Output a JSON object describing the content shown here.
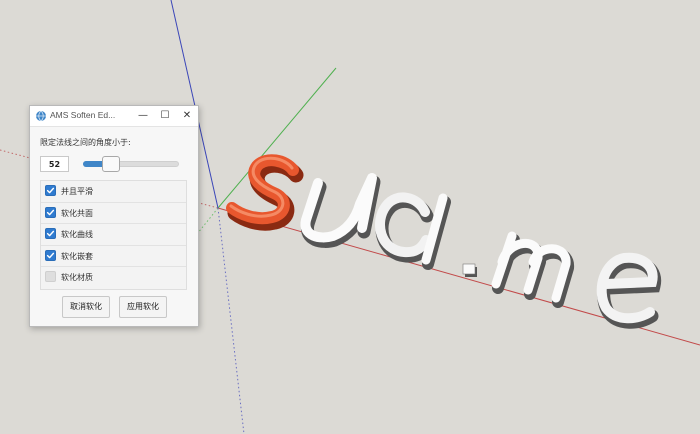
{
  "window": {
    "title": "AMS Soften Ed...",
    "minimize_glyph": "—",
    "maximize_glyph": "☐",
    "close_glyph": "✕"
  },
  "angle": {
    "label": "限定法线之间的角度小于:",
    "value": "52",
    "slider_min": 0,
    "slider_max": 180
  },
  "options": [
    {
      "label": "并且平滑",
      "checked": true
    },
    {
      "label": "软化共面",
      "checked": true
    },
    {
      "label": "软化曲线",
      "checked": true
    },
    {
      "label": "软化嵌套",
      "checked": true
    },
    {
      "label": "软化材质",
      "checked": false
    }
  ],
  "buttons": {
    "cancel_label": "取消软化",
    "apply_label": "应用软化"
  },
  "scene": {
    "text": "suci.me",
    "highlighted_letter": "s",
    "colors": {
      "background": "#dcdad5",
      "highlight": "#e8572e",
      "axis_red": "#c24a4a",
      "axis_green": "#4fb04f",
      "axis_blue": "#3b46b8",
      "checkbox": "#2f7bd0"
    }
  }
}
